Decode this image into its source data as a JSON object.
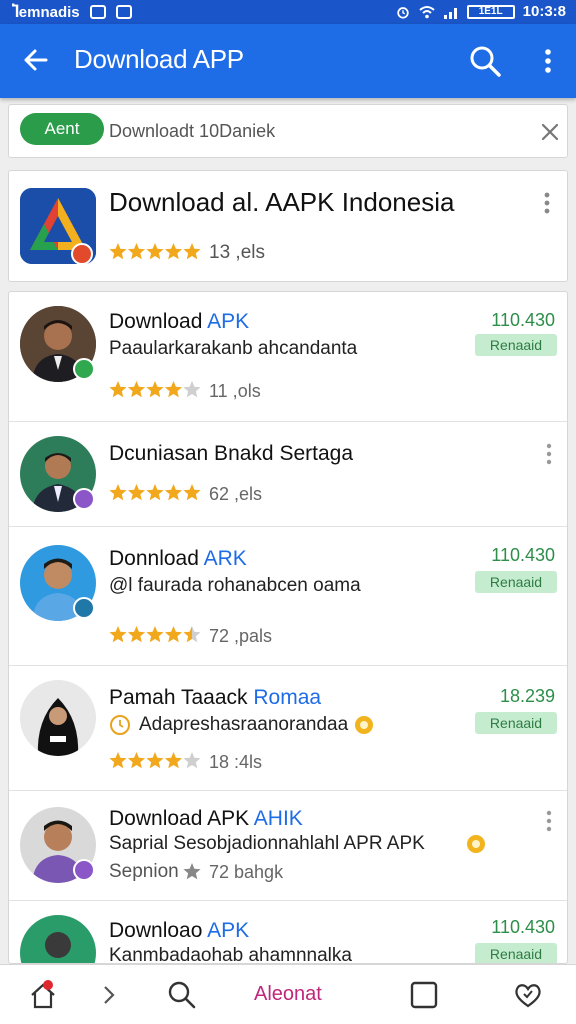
{
  "status_bar": {
    "carrier": "Ⴈemnadis",
    "time": "10:3:8",
    "battery": "1E1L"
  },
  "app_bar": {
    "title": "Download APP"
  },
  "filter": {
    "chip": "Aent",
    "query": "Downloadt 10Daniek"
  },
  "featured": {
    "name": "Download al. AAPK Indonesia",
    "rating_stars": 5,
    "count": "13 ,els"
  },
  "rows": [
    {
      "title_main": "Download ",
      "title_accent": "APK",
      "subtitle": "Paaularkarakanb ahcandanta",
      "rating_stars": 4,
      "count": "11 ,ols",
      "number": "110.430",
      "button": "Renaaid"
    },
    {
      "title_main": "Dcuniasan Bnakd Sertaga",
      "title_accent": "",
      "subtitle": "",
      "rating_stars": 5,
      "count": "62 ,els",
      "number": "",
      "button": ""
    },
    {
      "title_main": "Donnload ",
      "title_accent": "ARK",
      "subtitle": "@l faurada rohanabcen oama",
      "rating_stars": 4.5,
      "count": "72 ,pals",
      "number": "110.430",
      "button": "Renaaid"
    },
    {
      "title_main": "Pamah Taaack ",
      "title_accent": "Romaa",
      "subtitle": "Adapreshasraanorandaa",
      "rating_stars": 4,
      "count": "18 :4ls",
      "number": "18.239",
      "button": "Renaaid"
    },
    {
      "title_main": "Download APK ",
      "title_accent": "AHIK",
      "subtitle": "Saprial Sesobjadionnahlahl APR APK",
      "third_line": "Sepnion",
      "rating_stars": 1,
      "count": "72 bahgk",
      "number": "",
      "button": ""
    },
    {
      "title_main": "Downloao ",
      "title_accent": "APK",
      "subtitle": "Kanmbadaohab ahamnnalka",
      "rating_stars": 0,
      "count": "",
      "number": "110.430",
      "button": "Renaaid"
    }
  ],
  "bottom_nav": {
    "label": "Aleonat"
  },
  "colors": {
    "primary": "#1e6ce6",
    "accent_green": "#2a9c4a",
    "star": "#f1a81c"
  }
}
